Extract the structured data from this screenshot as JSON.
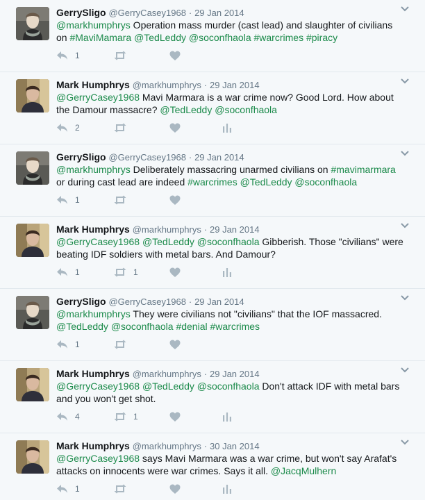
{
  "colors": {
    "background": "#f5f8fa",
    "link": "#1b8a4a",
    "muted": "#657786",
    "icon": "#aab8c2"
  },
  "tweets": [
    {
      "author": "GerrySligo",
      "handle": "@GerryCasey1968",
      "separator": "·",
      "date": "29 Jan 2014",
      "avatar": "avatar-gerry",
      "segments": [
        {
          "text": "@markhumphrys",
          "link": true
        },
        {
          "text": " Operation mass murder (cast lead) and slaughter of civilians on ",
          "link": false
        },
        {
          "text": "#MaviMamara",
          "link": true
        },
        {
          "text": " ",
          "link": false
        },
        {
          "text": "@TedLeddy",
          "link": true
        },
        {
          "text": " ",
          "link": false
        },
        {
          "text": "@soconfhaola",
          "link": true
        },
        {
          "text": " ",
          "link": false
        },
        {
          "text": "#warcrimes",
          "link": true
        },
        {
          "text": " ",
          "link": false
        },
        {
          "text": "#piracy",
          "link": true
        }
      ],
      "reply_count": "1",
      "retweet_count": "",
      "has_analytics": false
    },
    {
      "author": "Mark Humphrys",
      "handle": "@markhumphrys",
      "separator": "·",
      "date": "29 Jan 2014",
      "avatar": "avatar-mark",
      "segments": [
        {
          "text": "@GerryCasey1968",
          "link": true
        },
        {
          "text": "  Mavi Marmara is a war crime now? Good Lord. How about the Damour massacre?  ",
          "link": false
        },
        {
          "text": "@TedLeddy",
          "link": true
        },
        {
          "text": " ",
          "link": false
        },
        {
          "text": "@soconfhaola",
          "link": true
        }
      ],
      "reply_count": "2",
      "retweet_count": "",
      "has_analytics": true
    },
    {
      "author": "GerrySligo",
      "handle": "@GerryCasey1968",
      "separator": "·",
      "date": "29 Jan 2014",
      "avatar": "avatar-gerry",
      "segments": [
        {
          "text": "@markhumphrys",
          "link": true
        },
        {
          "text": " Deliberately massacring unarmed civilians on ",
          "link": false
        },
        {
          "text": "#mavimarmara",
          "link": true
        },
        {
          "text": " or during cast lead are indeed ",
          "link": false
        },
        {
          "text": "#warcrimes",
          "link": true
        },
        {
          "text": " ",
          "link": false
        },
        {
          "text": "@TedLeddy",
          "link": true
        },
        {
          "text": " ",
          "link": false
        },
        {
          "text": "@soconfhaola",
          "link": true
        }
      ],
      "reply_count": "1",
      "retweet_count": "",
      "has_analytics": false
    },
    {
      "author": "Mark Humphrys",
      "handle": "@markhumphrys",
      "separator": "·",
      "date": "29 Jan 2014",
      "avatar": "avatar-mark",
      "segments": [
        {
          "text": "@GerryCasey1968",
          "link": true
        },
        {
          "text": " ",
          "link": false
        },
        {
          "text": "@TedLeddy",
          "link": true
        },
        {
          "text": " ",
          "link": false
        },
        {
          "text": "@soconfhaola",
          "link": true
        },
        {
          "text": " Gibberish. Those \"civilians\" were beating IDF soldiers with metal bars. And Damour?",
          "link": false
        }
      ],
      "reply_count": "1",
      "retweet_count": "1",
      "has_analytics": true
    },
    {
      "author": "GerrySligo",
      "handle": "@GerryCasey1968",
      "separator": "·",
      "date": "29 Jan 2014",
      "avatar": "avatar-gerry",
      "segments": [
        {
          "text": "@markhumphrys",
          "link": true
        },
        {
          "text": " They were civilians not \"civilians\" that the IOF massacred. ",
          "link": false
        },
        {
          "text": "@TedLeddy",
          "link": true
        },
        {
          "text": " ",
          "link": false
        },
        {
          "text": "@soconfhaola",
          "link": true
        },
        {
          "text": " ",
          "link": false
        },
        {
          "text": "#denial",
          "link": true
        },
        {
          "text": " ",
          "link": false
        },
        {
          "text": "#warcrimes",
          "link": true
        }
      ],
      "reply_count": "1",
      "retweet_count": "",
      "has_analytics": false
    },
    {
      "author": "Mark Humphrys",
      "handle": "@markhumphrys",
      "separator": "·",
      "date": "29 Jan 2014",
      "avatar": "avatar-mark",
      "segments": [
        {
          "text": "@GerryCasey1968",
          "link": true
        },
        {
          "text": " ",
          "link": false
        },
        {
          "text": "@TedLeddy",
          "link": true
        },
        {
          "text": " ",
          "link": false
        },
        {
          "text": "@soconfhaola",
          "link": true
        },
        {
          "text": " Don't attack IDF with metal bars and you won't get shot.",
          "link": false
        }
      ],
      "reply_count": "4",
      "retweet_count": "1",
      "has_analytics": true
    },
    {
      "author": "Mark Humphrys",
      "handle": "@markhumphrys",
      "separator": "·",
      "date": "30 Jan 2014",
      "avatar": "avatar-mark",
      "segments": [
        {
          "text": "@GerryCasey1968",
          "link": true
        },
        {
          "text": " says Mavi Marmara was a war crime, but won't say Arafat's attacks on innocents were war crimes. Says it all. ",
          "link": false
        },
        {
          "text": "@JacqMulhern",
          "link": true
        }
      ],
      "reply_count": "1",
      "retweet_count": "",
      "has_analytics": true
    }
  ]
}
